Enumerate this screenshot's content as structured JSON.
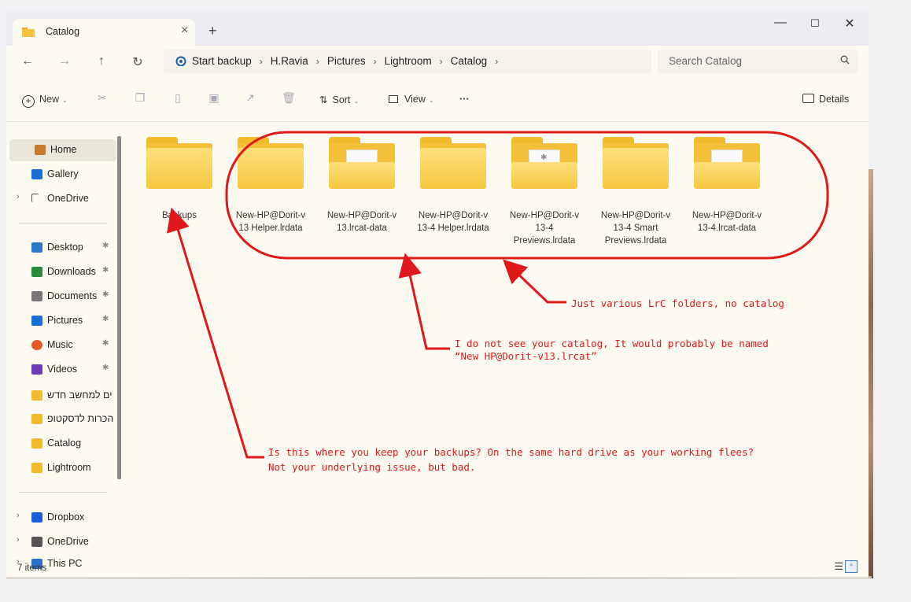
{
  "window": {
    "tab_title": "Catalog",
    "tab_close": "×",
    "new_tab": "+",
    "minimize": "—",
    "maximize": "☐",
    "close": "✕"
  },
  "nav": {
    "back": "←",
    "forward": "→",
    "up": "↑",
    "refresh": "↻",
    "breadcrumbs": [
      "Start backup",
      "H.Ravia",
      "Pictures",
      "Lightroom",
      "Catalog"
    ],
    "separator": "›",
    "search_placeholder": "Search Catalog"
  },
  "commands": {
    "new": "New",
    "sort": "Sort",
    "view": "View",
    "more": "···",
    "details": "Details"
  },
  "sidebar": {
    "items": [
      {
        "label": "Home",
        "icon": "home-icon",
        "selected": true
      },
      {
        "label": "Gallery",
        "icon": "gallery-icon"
      },
      {
        "label": "OneDrive",
        "icon": "onedrive-icon",
        "expandable": true
      },
      {
        "label": "Desktop",
        "icon": "desktop-icon",
        "pinned": true
      },
      {
        "label": "Downloads",
        "icon": "downloads-icon",
        "pinned": true
      },
      {
        "label": "Documents",
        "icon": "documents-icon",
        "pinned": true
      },
      {
        "label": "Pictures",
        "icon": "pictures-icon",
        "pinned": true
      },
      {
        "label": "Music",
        "icon": "music-icon",
        "pinned": true
      },
      {
        "label": "Videos",
        "icon": "videos-icon",
        "pinned": true
      },
      {
        "label": "ים למחשב חדש",
        "icon": "folder-icon"
      },
      {
        "label": "הכרות לדסקטופ",
        "icon": "folder-icon"
      },
      {
        "label": "Catalog",
        "icon": "folder-icon"
      },
      {
        "label": "Lightroom",
        "icon": "folder-icon"
      },
      {
        "label": "Dropbox",
        "icon": "dropbox-icon",
        "expandable": true
      },
      {
        "label": "OneDrive",
        "icon": "onedrive-icon",
        "expandable": true
      },
      {
        "label": "This PC",
        "icon": "pc-icon",
        "expandable": true
      }
    ],
    "pin_glyph": "📌",
    "expand_glyph": "›"
  },
  "status": {
    "item_count": "7 items"
  },
  "folders": [
    {
      "name": "Backups",
      "content": "empty"
    },
    {
      "name": "New-HP@Dorit-v 13 Helper.lrdata",
      "content": "empty"
    },
    {
      "name": "New-HP@Dorit-v 13.lrcat-data",
      "content": "doc"
    },
    {
      "name": "New-HP@Dorit-v 13-4 Helper.lrdata",
      "content": "empty"
    },
    {
      "name": "New-HP@Dorit-v 13-4 Previews.lrdata",
      "content": "doc-star"
    },
    {
      "name": "New-HP@Dorit-v 13-4 Smart Previews.lrdata",
      "content": "empty"
    },
    {
      "name": "New-HP@Dorit-v 13-4.lrcat-data",
      "content": "doc"
    }
  ],
  "annotations": {
    "note1": "Just various LrC folders, no catalog",
    "note2_line1": "I do not see your catalog, It would probably be named",
    "note2_line2": "“New HP@Dorit-v13.lrcat”",
    "note3_line1": "Is this where you keep your backups? On the same hard drive as your working flees?",
    "note3_line2": "Not your underlying issue, but bad.",
    "color": "#e0181c"
  }
}
